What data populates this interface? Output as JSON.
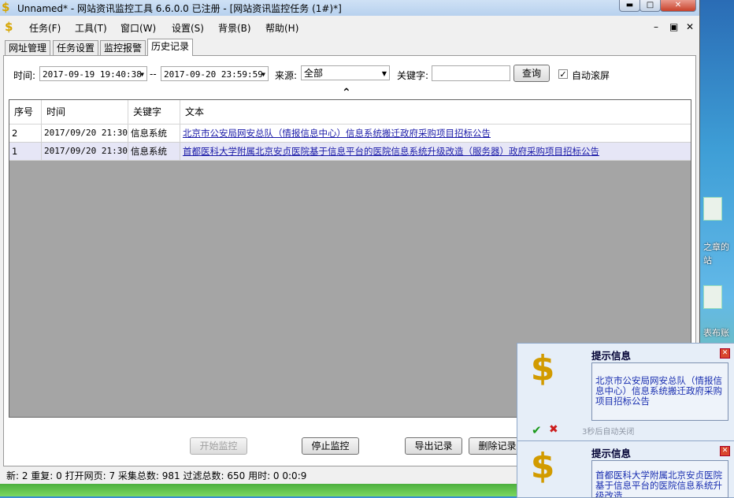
{
  "window": {
    "title": "Unnamed* - 网站资讯监控工具 6.6.0.0  已注册 - [网站资讯监控任务  (1#)*]",
    "app_icon": "dollar-key-icon",
    "buttons": {
      "minimize": "▬",
      "maximize": "□",
      "close": "✕"
    }
  },
  "menu": {
    "items": [
      "任务(F)",
      "工具(T)",
      "窗口(W)",
      "设置(S)",
      "背景(B)",
      "帮助(H)"
    ],
    "mdi": {
      "minimize": "–",
      "restore": "🗗",
      "close": "✕"
    }
  },
  "tabs": [
    {
      "label": "网址管理",
      "active": false
    },
    {
      "label": "任务设置",
      "active": false
    },
    {
      "label": "监控报警",
      "active": false
    },
    {
      "label": "历史记录",
      "active": true
    }
  ],
  "filter": {
    "time_label": "时间:",
    "start": "2017-09-19 19:40:38",
    "separator": "--",
    "end": "2017-09-20 23:59:59",
    "source_label": "来源:",
    "source_value": "全部",
    "keyword_label": "关键字:",
    "keyword_value": "",
    "query_button": "查询",
    "auto_scroll_label": "自动滚屏",
    "auto_scroll_checked": true
  },
  "list": {
    "columns": [
      "序号",
      "时间",
      "关键字",
      "文本"
    ],
    "rows": [
      {
        "seq": "2",
        "time": "2017/09/20 21:30",
        "keyword": "信息系统",
        "text": "北京市公安局网安总队（情报信息中心）信息系统搬迁政府采购项目招标公告",
        "selected": false
      },
      {
        "seq": "1",
        "time": "2017/09/20 21:30",
        "keyword": "信息系统",
        "text": "首都医科大学附属北京安贞医院基于信息平台的医院信息系统升级改造（服务器）政府采购项目招标公告",
        "selected": true
      }
    ]
  },
  "actions": {
    "start": "开始监控",
    "stop": "停止监控",
    "export": "导出记录",
    "delete": "删除记录"
  },
  "status": "新:  2  重复:  0  打开网页:  7  采集总数:  981  过滤总数:  650  用时:  0 0:0:9",
  "popups": [
    {
      "title": "提示信息",
      "body": "北京市公安局网安总队（情报信息中心）信息系统搬迁政府采购项目招标公告",
      "auto_close": "3秒后自动关闭"
    },
    {
      "title": "提示信息",
      "body": "首都医科大学附属北京安贞医院基于信息平台的医院信息系统升级改造"
    }
  ],
  "desktop": {
    "labels": [
      "之章的",
      "站",
      "表布账"
    ]
  },
  "colors": {
    "link": "#1a1aa8",
    "selected_row": "#e6e6f6",
    "list_bg": "#a5a5a5"
  }
}
